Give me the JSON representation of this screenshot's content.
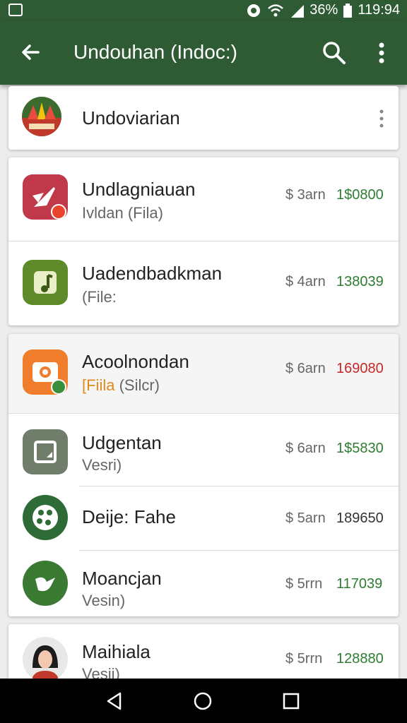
{
  "status_bar": {
    "battery_percent": "36%",
    "time": "119:94"
  },
  "app_bar": {
    "title": "Undouhan (Indoc:)"
  },
  "header_card": {
    "name": "Undoviarian"
  },
  "items": [
    {
      "name": "Undlagniauan",
      "sub": "Ivldan (Fila)",
      "price": "$ 3arn",
      "amount": "1$0800",
      "amount_color": "#2e7d32"
    },
    {
      "name": "Uadendbadkman",
      "sub": "(File:",
      "price": "$ 4arn",
      "amount": "138039",
      "amount_color": "#2e7d32"
    },
    {
      "name": "Acoolnondan",
      "sub_highlight": "[Fiila",
      "sub": "(Silcr)",
      "price": "$ 6arn",
      "amount": "169080",
      "amount_color": "#c62828"
    },
    {
      "name": "Udgentan",
      "sub": "Vesri)",
      "price": "$ 6arn",
      "amount": "1$5830",
      "amount_color": "#2e7d32"
    },
    {
      "name": "Deije: Fahe",
      "sub": "",
      "price": "$ 5arn",
      "amount": "189650",
      "amount_color": "#333333"
    },
    {
      "name": "Moancjan",
      "sub": "Vesin)",
      "price": "$ 5rrn",
      "amount": "117039",
      "amount_color": "#2e7d32"
    },
    {
      "name": "Maihiala",
      "sub": "Vesii)",
      "price": "$ 5rrn",
      "amount": "128880",
      "amount_color": "#2e7d32"
    }
  ],
  "icons": [
    "arrow-back-icon",
    "search-icon",
    "more-vert-icon",
    "rocket-icon",
    "music-note-icon",
    "camera-icon",
    "image-icon",
    "palette-icon",
    "bird-icon",
    "avatar"
  ]
}
